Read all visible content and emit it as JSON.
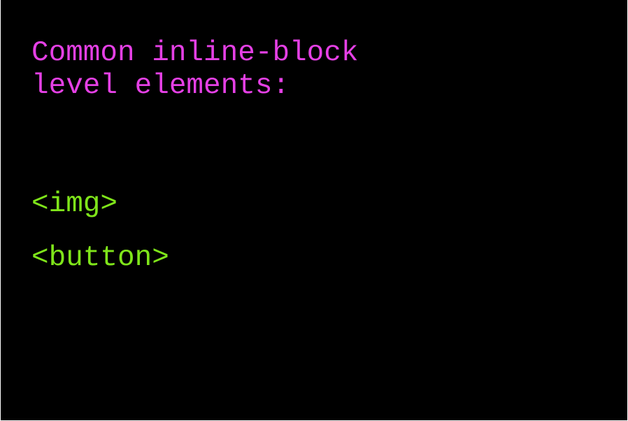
{
  "slide": {
    "heading_line1": "Common inline-block",
    "heading_line2": "level elements:",
    "items": [
      "<img>",
      "<button>"
    ]
  },
  "colors": {
    "background": "#000000",
    "heading": "#e540e5",
    "items": "#7fe51a"
  }
}
